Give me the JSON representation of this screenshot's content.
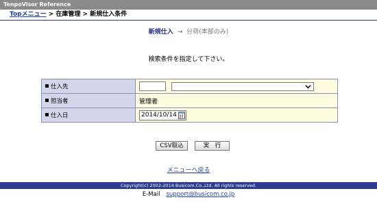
{
  "app_title": "TenpoVisor Reference",
  "breadcrumb": {
    "top": "Topメニュー",
    "sep1": " > ",
    "inventory": "在庫管理",
    "sep2": " > ",
    "current": "新規仕入条件"
  },
  "steps": {
    "active": "新規仕入",
    "arrow": "→",
    "next": "分荷(本部のみ)"
  },
  "instruction": "検索条件を指定して下さい。",
  "form": {
    "supplier": {
      "label": "仕入先",
      "code_value": "",
      "select_value": ""
    },
    "person": {
      "label": "担当者",
      "value": "管理者"
    },
    "date": {
      "label": "仕入日",
      "value": "2014/10/14"
    }
  },
  "buttons": {
    "csv": "CSV取込",
    "run": "実　行"
  },
  "back_link": "メニューへ戻る",
  "footer": {
    "copyright": "Copyright(c) 2002-2014 Busicom.Co.,Ltd. All rights reserved.",
    "mail_label": "E-Mail",
    "mail_address": "support@busicom.co.jp"
  },
  "colors": {
    "title_bar": "#8a8a8a",
    "accent": "#2c3b8e",
    "label_bg": "#d3d6ea",
    "value_bg": "#fefbdf",
    "link": "#1a3fb8"
  },
  "icons": {
    "dropdown": "chevron-down-icon",
    "calendar": "calendar-icon"
  }
}
